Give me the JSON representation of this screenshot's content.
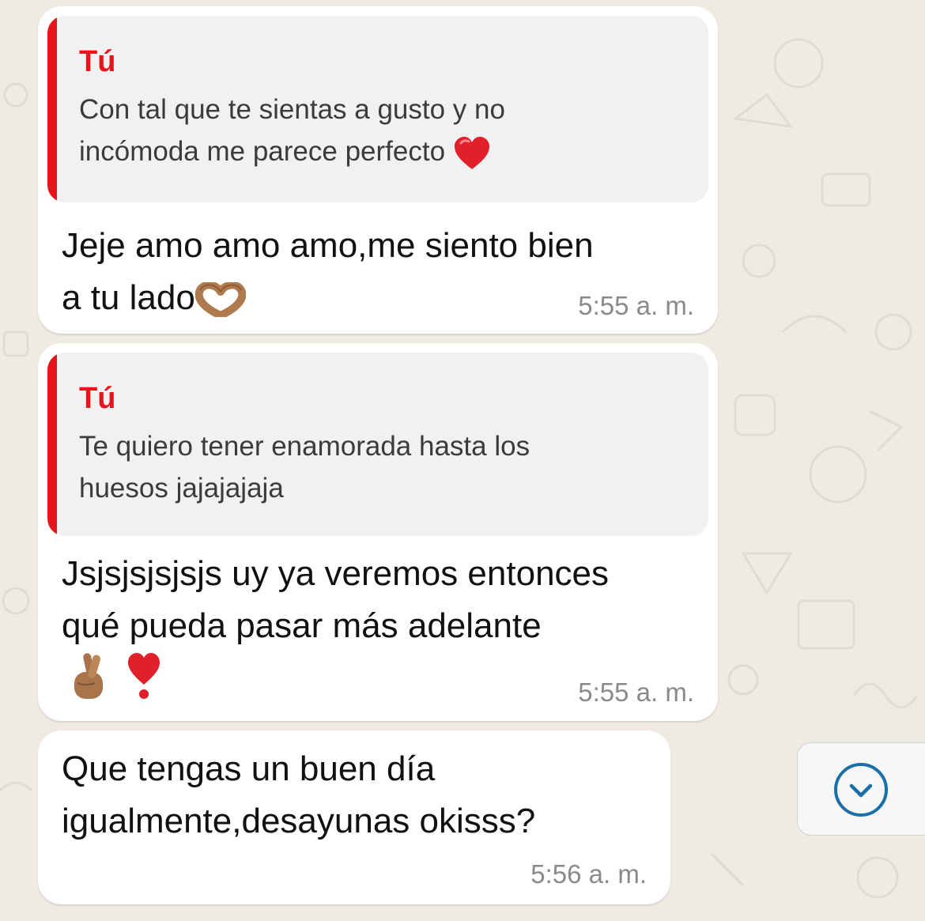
{
  "messages": [
    {
      "quote": {
        "author": "Tú",
        "text": "Con tal que te sientas a gusto y no\nincómoda me parece perfecto ",
        "emoji_icon": "red-heart-icon"
      },
      "text": "Jeje amo amo amo,me siento bien\na tu lado",
      "emoji_icon": "heart-hands-icon",
      "time": "5:55 a. m."
    },
    {
      "quote": {
        "author": "Tú",
        "text": "Te quiero tener enamorada hasta los\nhuesos jajajajaja"
      },
      "text": "Jsjsjsjsjsjs uy ya veremos entonces\nqué pueda pasar más adelante",
      "emoji_icons": [
        "crossed-fingers-icon",
        "heart-exclamation-icon"
      ],
      "time": "5:55 a. m."
    },
    {
      "text": "Que tengas un buen día\nigualmente,desayunas okisss?",
      "time": "5:56 a. m."
    }
  ],
  "scroll_button": {
    "icon": "chevron-down-circle-icon",
    "color": "#1a6fa8"
  },
  "colors": {
    "quote_accent": "#e8141a",
    "background": "#efeae2",
    "bubble": "#ffffff"
  }
}
